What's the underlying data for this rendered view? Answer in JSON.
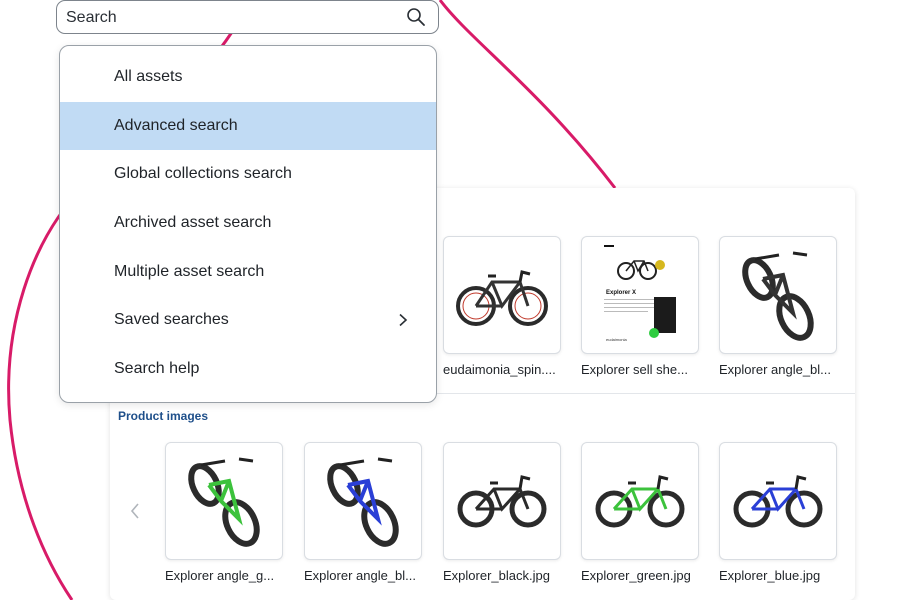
{
  "search": {
    "placeholder": "Search",
    "icon": "search-icon"
  },
  "menu": {
    "items": [
      {
        "label": "All assets",
        "selected": false
      },
      {
        "label": "Advanced search",
        "selected": true
      },
      {
        "label": "Global collections search",
        "selected": false
      },
      {
        "label": "Archived asset search",
        "selected": false
      },
      {
        "label": "Multiple asset search",
        "selected": false
      },
      {
        "label": "Saved searches",
        "selected": false,
        "submenu": true
      },
      {
        "label": "Search help",
        "selected": false
      }
    ]
  },
  "assets_row1": [
    {
      "name": "eudaimonia_spin....",
      "thumb": "road-bike"
    },
    {
      "name": "Explorer sell she...",
      "thumb": "sell-sheet",
      "sheet_title": "Explorer X",
      "sheet_footer": "eudaimonia"
    },
    {
      "name": "Explorer angle_bl...",
      "thumb": "mtb-angle-black"
    }
  ],
  "product_images": {
    "title": "Product images",
    "items": [
      {
        "name": "Explorer angle_g...",
        "thumb": "mtb-angle-green"
      },
      {
        "name": "Explorer angle_bl...",
        "thumb": "mtb-angle-blue"
      },
      {
        "name": "Explorer_black.jpg",
        "thumb": "mtb-side-black"
      },
      {
        "name": "Explorer_green.jpg",
        "thumb": "mtb-side-green"
      },
      {
        "name": "Explorer_blue.jpg",
        "thumb": "mtb-side-blue"
      }
    ]
  },
  "colors": {
    "accent_curve": "#d81b68",
    "selected_bg": "#c1dbf4",
    "section_title": "#1e4f8a",
    "bike_green": "#3cc23c",
    "bike_blue": "#2a3fd6",
    "bike_black": "#2b2b2b"
  }
}
